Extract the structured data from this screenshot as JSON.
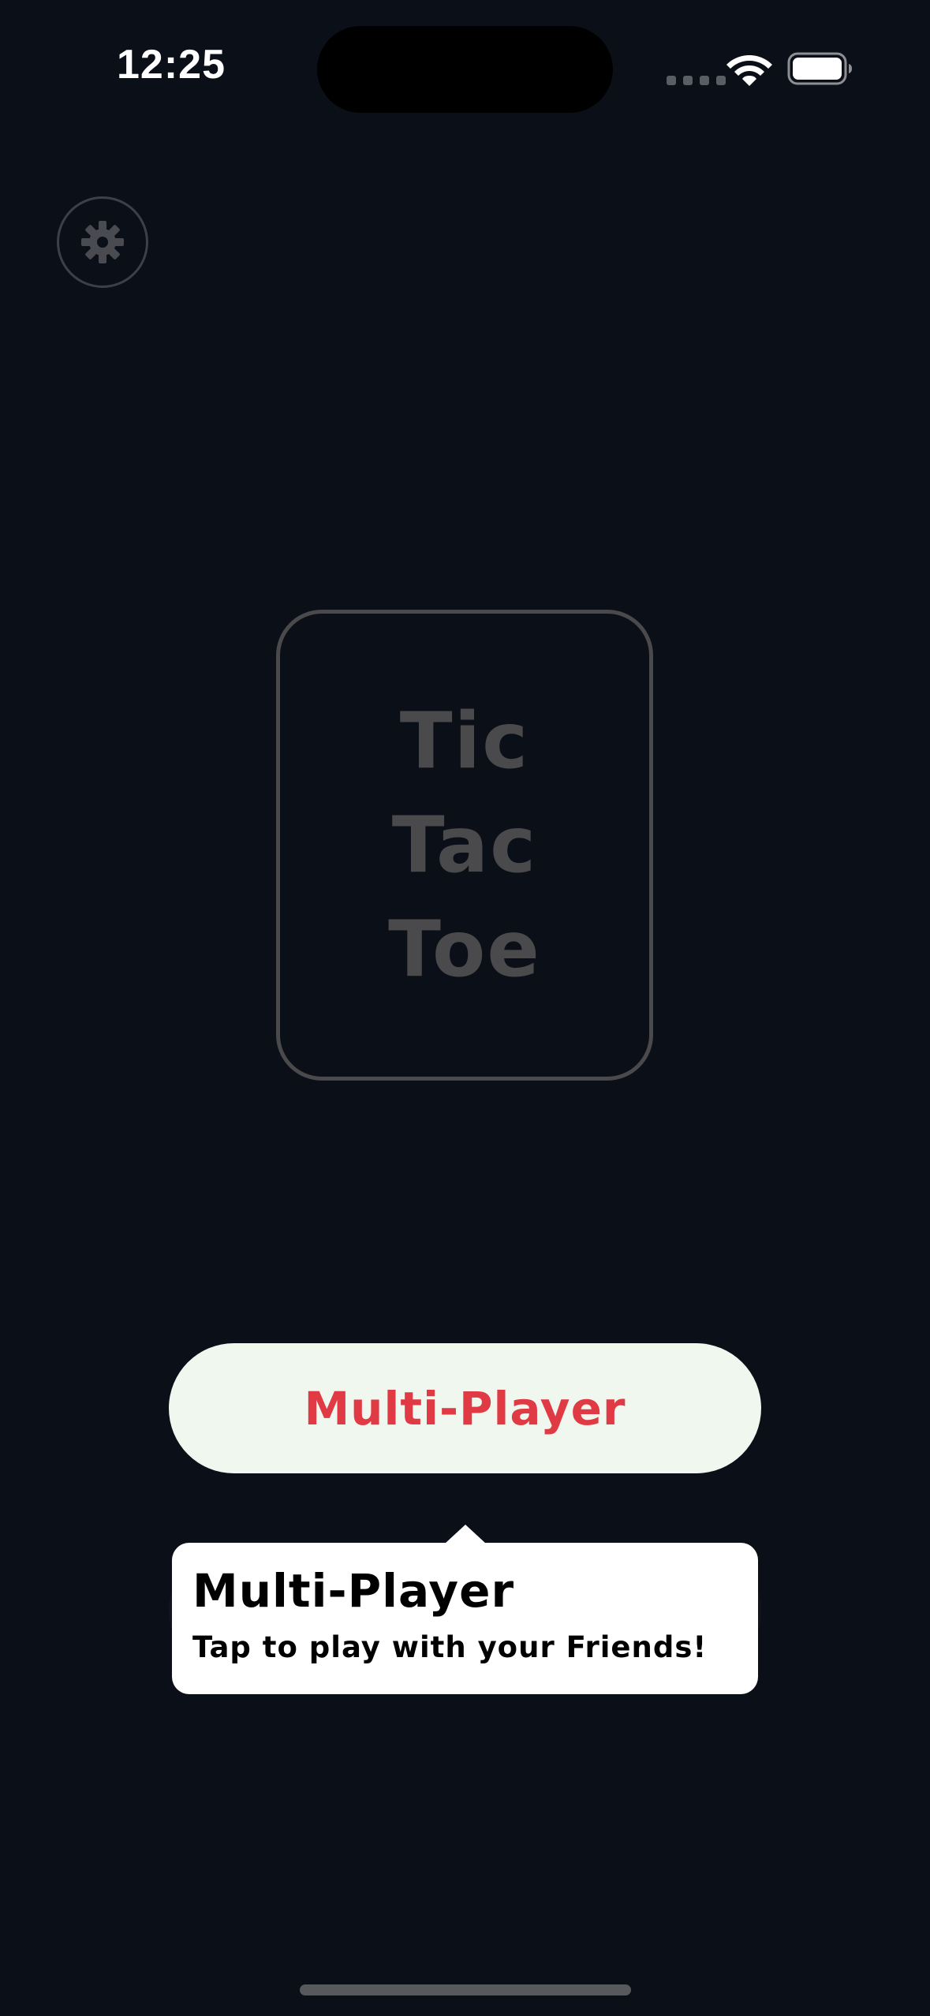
{
  "status_bar": {
    "time": "12:25",
    "icons": [
      "signal-dots-icon",
      "wifi-icon",
      "battery-icon"
    ]
  },
  "settings": {
    "icon": "gear-icon"
  },
  "logo": {
    "lines": [
      "Tic",
      "Tac",
      "Toe"
    ]
  },
  "main": {
    "multiplayer_label": "Multi-Player"
  },
  "tooltip": {
    "title": "Multi-Player",
    "text": "Tap to play with your Friends!"
  },
  "colors": {
    "background": "#0b0f18",
    "button_bg": "#f0f7ee",
    "accent_red": "#e03a45",
    "muted_gray": "#4a4a4c",
    "tooltip_bg": "#ffffff"
  }
}
